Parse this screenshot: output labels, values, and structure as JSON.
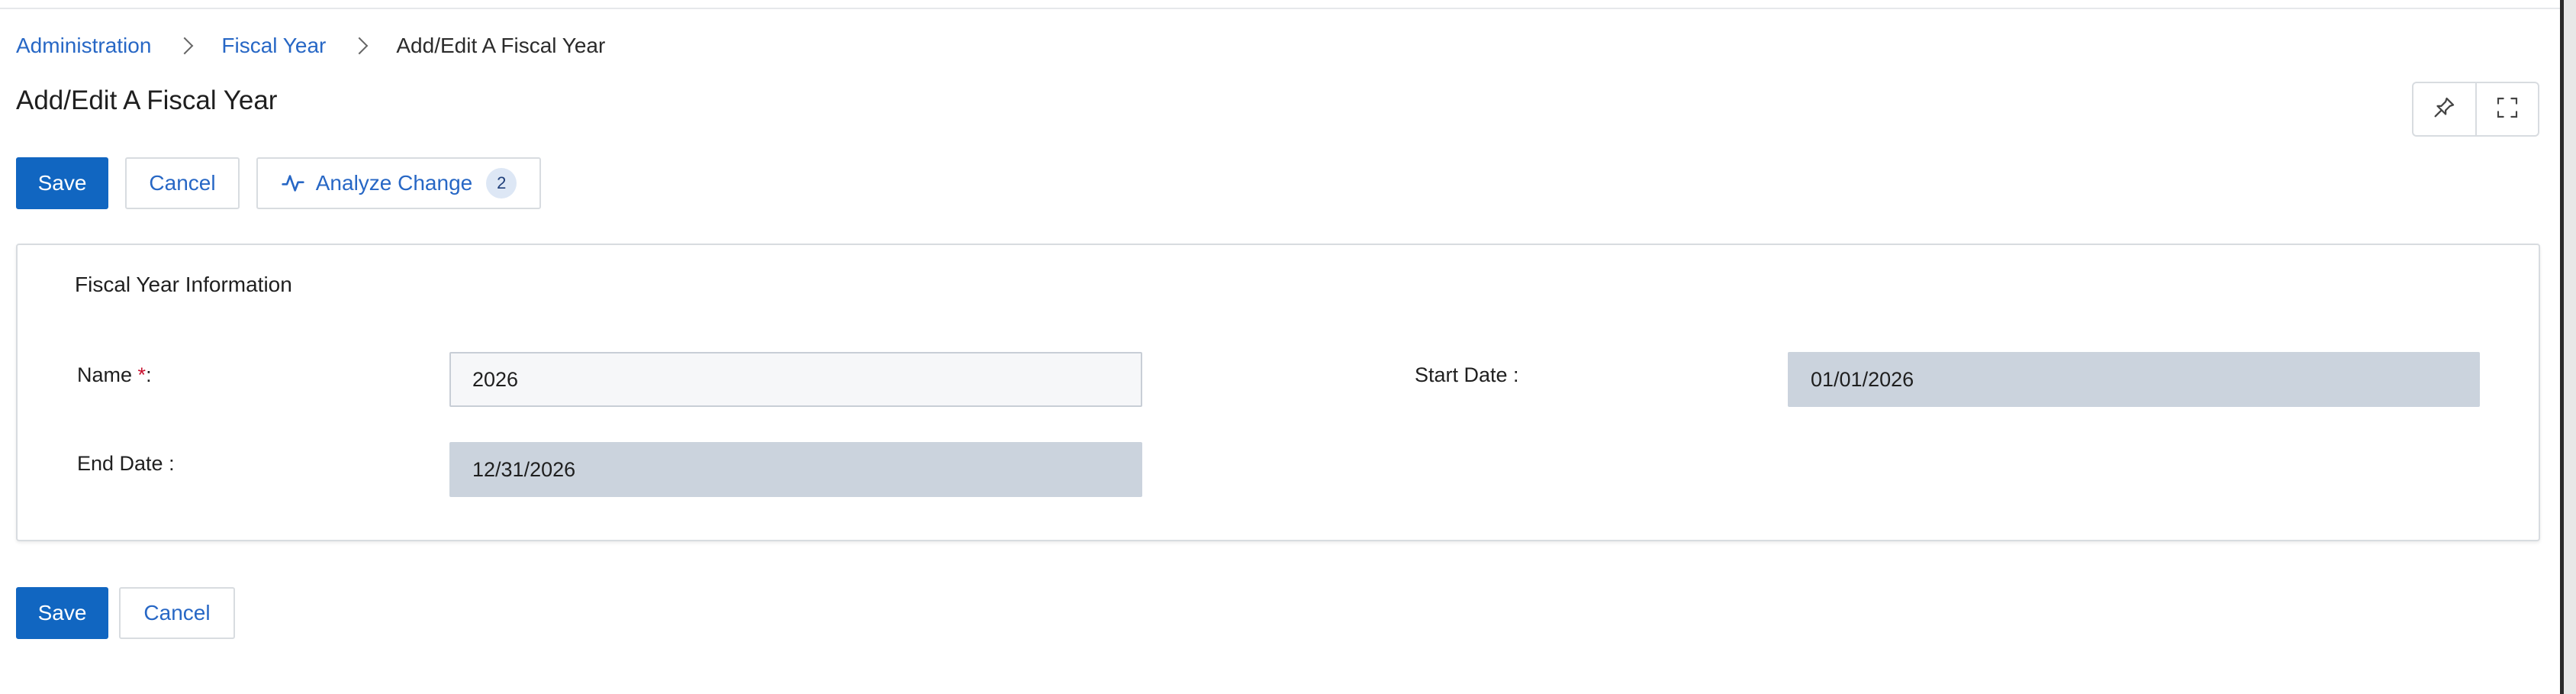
{
  "breadcrumb": {
    "items": [
      "Administration",
      "Fiscal Year"
    ],
    "current": "Add/Edit A Fiscal Year"
  },
  "page": {
    "title": "Add/Edit A Fiscal Year"
  },
  "toolbar": {
    "save_label": "Save",
    "cancel_label": "Cancel",
    "analyze_label": "Analyze Change",
    "analyze_count": "2"
  },
  "form": {
    "section_title": "Fiscal Year Information",
    "name": {
      "label": "Name",
      "required_mark": "*",
      "suffix": ":",
      "value": "2026"
    },
    "start_date": {
      "label": "Start Date :",
      "value": "01/01/2026"
    },
    "end_date": {
      "label": "End Date :",
      "value": "12/31/2026"
    }
  },
  "footer": {
    "save_label": "Save",
    "cancel_label": "Cancel"
  },
  "icons": {
    "pin": "pin-icon",
    "fullscreen": "fullscreen-icon",
    "analyze": "activity-icon"
  },
  "colors": {
    "primary": "#1166c1",
    "link": "#2767c5",
    "disabled_field": "#cbd3dd",
    "required": "#c8102e"
  }
}
